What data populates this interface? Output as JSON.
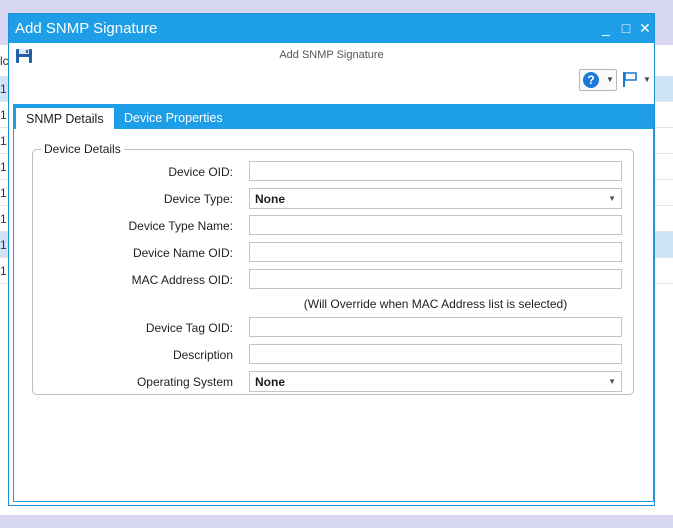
{
  "background": {
    "header_fragment": "lc",
    "row_fragment": "1"
  },
  "window": {
    "title": "Add SNMP Signature",
    "minimize_glyph": "_",
    "maximize_glyph": "□",
    "close_glyph": "✕",
    "accent_color": "#1e9ee6"
  },
  "toolbar": {
    "title": "Add SNMP Signature",
    "save_icon": "save-disk-icon",
    "help_icon": "help-icon",
    "help_glyph": "?",
    "flag_icon": "flag-icon"
  },
  "tabs": [
    {
      "label": "SNMP Details"
    },
    {
      "label": "Device Properties"
    }
  ],
  "group": {
    "title": "Device Details"
  },
  "fields": {
    "device_oid": {
      "label": "Device OID:",
      "value": ""
    },
    "device_type": {
      "label": "Device Type:",
      "value": "None"
    },
    "device_type_name": {
      "label": "Device Type Name:",
      "value": ""
    },
    "device_name_oid": {
      "label": "Device Name OID:",
      "value": ""
    },
    "mac_address_oid": {
      "label": "MAC Address OID:",
      "value": ""
    },
    "mac_note": "(Will Override when MAC Address list is selected)",
    "device_tag_oid": {
      "label": "Device Tag OID:",
      "value": ""
    },
    "description": {
      "label": "Description",
      "value": ""
    },
    "operating_system": {
      "label": "Operating System",
      "value": "None"
    }
  }
}
